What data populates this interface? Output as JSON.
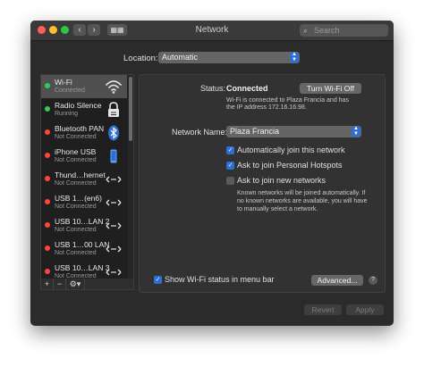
{
  "window": {
    "title": "Network"
  },
  "search": {
    "placeholder": "Search"
  },
  "location": {
    "label": "Location:",
    "value": "Automatic"
  },
  "services": [
    {
      "name": "Wi-Fi",
      "status": "Connected",
      "dot_color": "#34c759",
      "icon": "wifi-icon",
      "selected": true
    },
    {
      "name": "Radio Silence",
      "status": "Running",
      "dot_color": "#34c759",
      "icon": "lock-icon"
    },
    {
      "name": "Bluetooth PAN",
      "status": "Not Connected",
      "dot_color": "#ff453a",
      "icon": "bluetooth-icon"
    },
    {
      "name": "iPhone USB",
      "status": "Not Connected",
      "dot_color": "#ff453a",
      "icon": "iphone-icon"
    },
    {
      "name": "Thund…hernet",
      "status": "Not Connected",
      "dot_color": "#ff453a",
      "icon": "ethernet-icon"
    },
    {
      "name": "USB 1…(en6)",
      "status": "Not Connected",
      "dot_color": "#ff453a",
      "icon": "ethernet-icon"
    },
    {
      "name": "USB 10…LAN 2",
      "status": "Not Connected",
      "dot_color": "#ff453a",
      "icon": "ethernet-icon"
    },
    {
      "name": "USB 1…00 LAN",
      "status": "Not Connected",
      "dot_color": "#ff453a",
      "icon": "ethernet-icon"
    },
    {
      "name": "USB 10…LAN 3",
      "status": "Not Connected",
      "dot_color": "#ff453a",
      "icon": "ethernet-icon"
    }
  ],
  "toolbar": {
    "add": "+",
    "remove": "−",
    "gear": "⚙▾"
  },
  "detail": {
    "status_label": "Status:",
    "status_value": "Connected",
    "turn_off_button": "Turn Wi-Fi Off",
    "status_desc_1": "Wi-Fi is connected to Plaza Francia and has",
    "status_desc_2": "the IP address 172.16.16.98.",
    "network_name_label": "Network Name:",
    "network_name_value": "Plaza Francia",
    "auto_join_label": "Automatically join this network",
    "auto_join_checked": true,
    "hotspots_label": "Ask to join Personal Hotspots",
    "hotspots_checked": true,
    "new_networks_label": "Ask to join new networks",
    "new_networks_checked": false,
    "new_networks_note_1": "Known networks will be joined automatically. If",
    "new_networks_note_2": "no known networks are available, you will have",
    "new_networks_note_3": "to manually select a network.",
    "show_status_label": "Show Wi-Fi status in menu bar",
    "show_status_checked": true,
    "advanced_button": "Advanced...",
    "help": "?"
  },
  "footer": {
    "revert": "Revert",
    "apply": "Apply"
  },
  "colors": {
    "accent": "#2e6fd6",
    "connected": "#34c759",
    "not_connected": "#ff453a"
  }
}
